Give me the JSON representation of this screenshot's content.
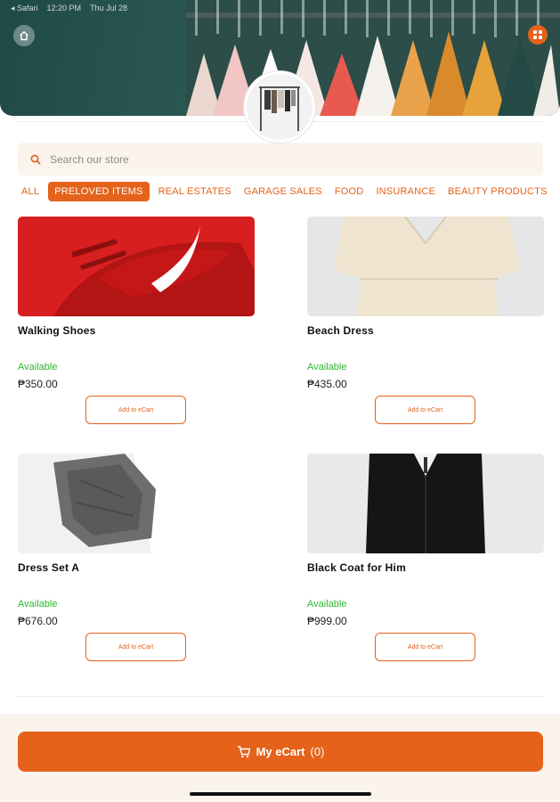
{
  "status_bar": {
    "carrier": "◂ Safari",
    "time": "12:20 PM",
    "date": "Thu Jul 28"
  },
  "search": {
    "placeholder": "Search our store"
  },
  "categories": [
    {
      "label": "ALL",
      "active": false
    },
    {
      "label": "PRELOVED ITEMS",
      "active": true
    },
    {
      "label": "REAL ESTATES",
      "active": false
    },
    {
      "label": "GARAGE SALES",
      "active": false
    },
    {
      "label": "FOOD",
      "active": false
    },
    {
      "label": "INSURANCE",
      "active": false
    },
    {
      "label": "BEAUTY PRODUCTS",
      "active": false
    }
  ],
  "products": [
    {
      "name": "Walking Shoes",
      "status": "Available",
      "price": "₱350.00",
      "button": "Add to eCart"
    },
    {
      "name": "Beach Dress",
      "status": "Available",
      "price": "₱435.00",
      "button": "Add to eCart"
    },
    {
      "name": "Dress Set A",
      "status": "Available",
      "price": "₱676.00",
      "button": "Add to eCart"
    },
    {
      "name": "Black Coat for Him",
      "status": "Available",
      "price": "₱999.00",
      "button": "Add to eCart"
    }
  ],
  "cart": {
    "label": "My eCart",
    "count": "(0)"
  },
  "colors": {
    "accent": "#e5621a",
    "available": "#2db82d",
    "footer_bg": "#fbf4ec"
  },
  "icons": {
    "home": "home-icon",
    "menu": "grid-menu-icon",
    "search": "search-icon",
    "cart": "cart-icon"
  }
}
